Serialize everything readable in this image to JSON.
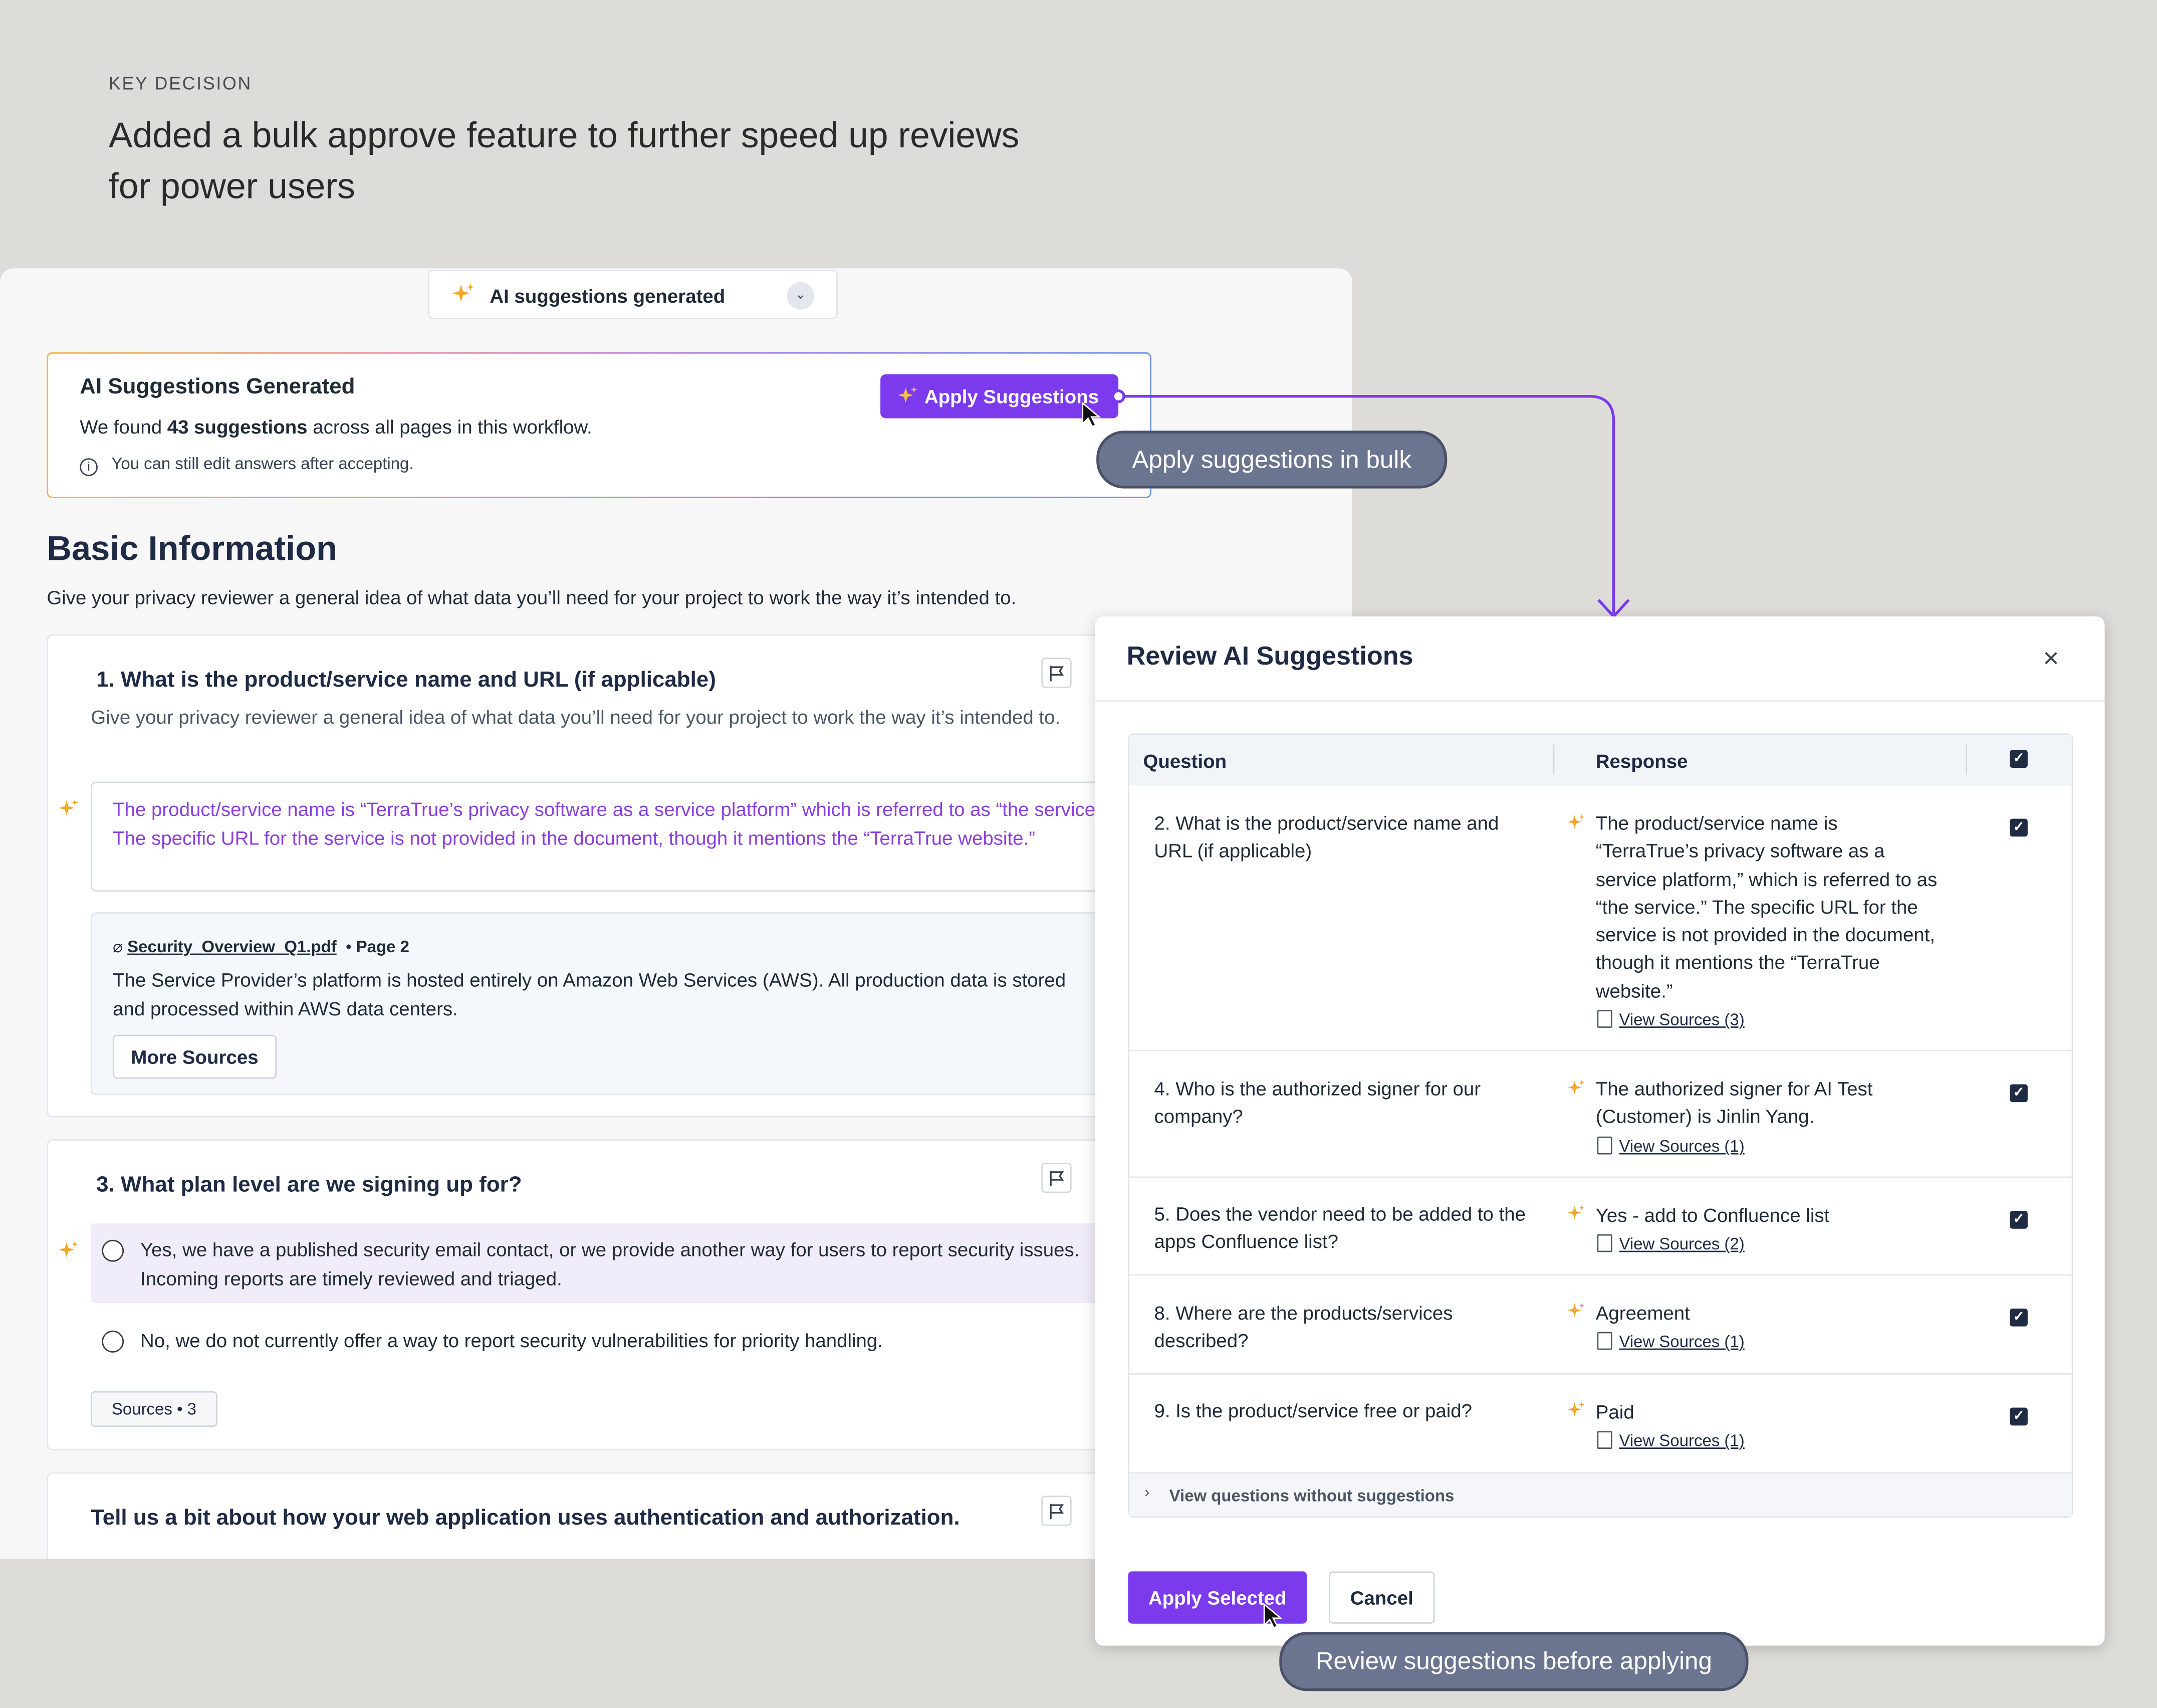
{
  "heading": {
    "kicker": "KEY DECISION",
    "title": "Added a bulk approve feature to further speed up reviews for power users"
  },
  "status_dropdown": {
    "label": "AI suggestions generated"
  },
  "banner": {
    "title": "AI Suggestions Generated",
    "desc_prefix": "We found ",
    "desc_count": "43 suggestions",
    "desc_suffix": " across all pages in this workflow.",
    "note": "You can still edit answers after accepting.",
    "apply_label": "Apply Suggestions"
  },
  "callouts": {
    "bulk": "Apply suggestions in bulk",
    "review": "Review suggestions before applying"
  },
  "section": {
    "title": "Basic Information",
    "desc": "Give your privacy reviewer a general idea of what data you’ll need for your project to work the way it’s intended to."
  },
  "q1": {
    "title": "1. What is the product/service name and URL (if applicable)",
    "desc": "Give your privacy reviewer a general idea of what data you’ll need for your project to work the way it’s intended to.",
    "answer": "The product/service name is “TerraTrue’s privacy software as a service platform” which is referred to as “the service.” The specific URL for the service is not provided in the document, though it mentions the “TerraTrue website.”",
    "source_file": "Security_Overview_Q1.pdf",
    "source_page": "Page 2",
    "source_text": "The Service Provider’s platform is hosted entirely on Amazon Web Services (AWS). All production data is stored and processed within AWS data centers.",
    "more_sources": "More Sources"
  },
  "q3": {
    "title": "3. What plan level are we signing up for?",
    "options": [
      "Yes, we have a published security email contact, or we provide another way for users to report security issues. Incoming reports are timely reviewed and triaged.",
      "No, we do not currently offer a way to report security vulnerabilities for priority handling."
    ],
    "sources": "Sources • 3"
  },
  "q4": {
    "title": "Tell us a bit about how your web application uses authentication and authorization."
  },
  "modal": {
    "title": "Review AI Suggestions",
    "col_question": "Question",
    "col_response": "Response",
    "rows": [
      {
        "question": "2. What is the product/service name and URL (if applicable)",
        "response": "The product/service name is “TerraTrue’s privacy software as a service platform,” which is referred to as “the service.” The specific URL for the service is not provided in the document, though it mentions the “TerraTrue website.”",
        "sources": "View Sources (3)"
      },
      {
        "question": "4. Who is the authorized signer for our company?",
        "response": "The authorized signer for AI Test (Customer) is Jinlin Yang.",
        "sources": "View Sources (1)"
      },
      {
        "question": "5. Does the vendor need to be added to the apps Confluence list?",
        "response": "Yes - add to Confluence list",
        "sources": "View Sources (2)"
      },
      {
        "question": "8. Where are the products/services described?",
        "response": "Agreement",
        "sources": "View Sources (1)"
      },
      {
        "question": "9. Is the product/service free or paid?",
        "response": "Paid",
        "sources": "View Sources (1)"
      }
    ],
    "footer_toggle": "View questions without suggestions",
    "apply_selected": "Apply Selected",
    "cancel": "Cancel"
  },
  "colors": {
    "accent": "#7c3aed",
    "sparkle": "#f0a92b",
    "callout": "#6b7590",
    "answer_text": "#8b3fe0"
  },
  "icons": [
    "sparkle-icon",
    "chevron-down-icon",
    "info-icon",
    "flag-icon",
    "paperclip-icon",
    "close-icon",
    "document-icon",
    "checkbox-icon",
    "cursor-icon"
  ]
}
